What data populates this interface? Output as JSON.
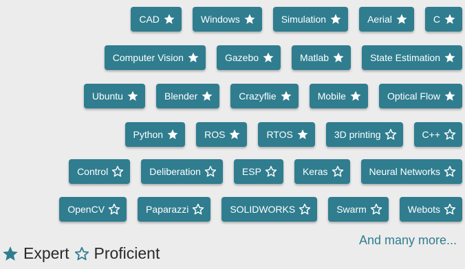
{
  "colors": {
    "tag_background": "#2f7d8f",
    "tag_text": "#ffffff",
    "accent": "#2f7d8f",
    "background": "#ececec",
    "legend_text": "#2a2a2a"
  },
  "skill_rows": [
    [
      {
        "label": "CAD",
        "level": "expert"
      },
      {
        "label": "Windows",
        "level": "expert"
      },
      {
        "label": "Simulation",
        "level": "expert"
      },
      {
        "label": "Aerial",
        "level": "expert"
      },
      {
        "label": "C",
        "level": "expert"
      }
    ],
    [
      {
        "label": "Computer Vision",
        "level": "expert"
      },
      {
        "label": "Gazebo",
        "level": "expert"
      },
      {
        "label": "Matlab",
        "level": "expert"
      },
      {
        "label": "State Estimation",
        "level": "expert"
      }
    ],
    [
      {
        "label": "Ubuntu",
        "level": "expert"
      },
      {
        "label": "Blender",
        "level": "expert"
      },
      {
        "label": "Crazyflie",
        "level": "expert"
      },
      {
        "label": "Mobile",
        "level": "expert"
      },
      {
        "label": "Optical Flow",
        "level": "expert"
      }
    ],
    [
      {
        "label": "Python",
        "level": "expert"
      },
      {
        "label": "ROS",
        "level": "expert"
      },
      {
        "label": "RTOS",
        "level": "expert"
      },
      {
        "label": "3D printing",
        "level": "proficient"
      },
      {
        "label": "C++",
        "level": "proficient"
      }
    ],
    [
      {
        "label": "Control",
        "level": "proficient"
      },
      {
        "label": "Deliberation",
        "level": "proficient"
      },
      {
        "label": "ESP",
        "level": "proficient"
      },
      {
        "label": "Keras",
        "level": "proficient"
      },
      {
        "label": "Neural Networks",
        "level": "proficient"
      }
    ],
    [
      {
        "label": "OpenCV",
        "level": "proficient"
      },
      {
        "label": "Paparazzi",
        "level": "proficient"
      },
      {
        "label": "SOLIDWORKS",
        "level": "proficient"
      },
      {
        "label": "Swarm",
        "level": "proficient"
      },
      {
        "label": "Webots",
        "level": "proficient"
      }
    ]
  ],
  "more_link": {
    "label": "And many more..."
  },
  "legend": {
    "expert_label": "Expert",
    "expert_icon": "star-filled-icon",
    "proficient_label": "Proficient",
    "proficient_icon": "star-outline-icon"
  }
}
